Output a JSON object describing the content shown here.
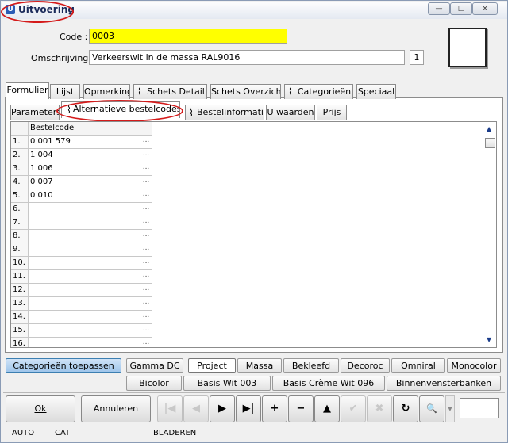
{
  "window": {
    "title": "Uitvoering",
    "title_icon": "U",
    "controls": [
      "—",
      "□",
      "×"
    ]
  },
  "form": {
    "code_label": "Code :",
    "code_value": "0003",
    "code_highlight_color": "#ffff00",
    "desc_label": "Omschrijving :",
    "desc_value": "Verkeerswit in de massa RAL9016",
    "desc_badge": "1"
  },
  "tabs_main": [
    "Formulier",
    "Lijst",
    "Opmerking",
    "Schets Detail",
    "Schets Overzicht",
    "Categorieën",
    "Speciaal"
  ],
  "tabs_sub": [
    "Parameters",
    "Alternatieve bestelcodes",
    "Bestelinformatie",
    "U waarden",
    "Prijs"
  ],
  "grid": {
    "column_header": "Bestelcode",
    "dots": "...",
    "rows": [
      {
        "n": "1.",
        "v": "0 001 579"
      },
      {
        "n": "2.",
        "v": "1 004"
      },
      {
        "n": "3.",
        "v": "1 006"
      },
      {
        "n": "4.",
        "v": "0 007"
      },
      {
        "n": "5.",
        "v": "0 010"
      },
      {
        "n": "6.",
        "v": ""
      },
      {
        "n": "7.",
        "v": ""
      },
      {
        "n": "8.",
        "v": ""
      },
      {
        "n": "9.",
        "v": ""
      },
      {
        "n": "10.",
        "v": ""
      },
      {
        "n": "11.",
        "v": ""
      },
      {
        "n": "12.",
        "v": ""
      },
      {
        "n": "13.",
        "v": ""
      },
      {
        "n": "14.",
        "v": ""
      },
      {
        "n": "15.",
        "v": ""
      },
      {
        "n": "16.",
        "v": ""
      }
    ]
  },
  "categories": {
    "apply": "Categorieën toepassen",
    "row1": [
      "Gamma DC",
      "Project",
      "Massa",
      "Bekleefd",
      "Decoroc",
      "Omniral",
      "Monocolor"
    ],
    "row2": [
      "Bicolor",
      "Basis Wit 003",
      "Basis Crème Wit 096",
      "Binnenvensterbanken"
    ]
  },
  "buttons": {
    "ok": "Ok",
    "cancel": "Annuleren"
  },
  "nav_icons": [
    "first-icon",
    "prev-icon",
    "next-icon",
    "last-icon",
    "add-icon",
    "delete-icon",
    "up-icon",
    "confirm-icon",
    "cancel-icon",
    "refresh-icon",
    "binoculars-icon"
  ],
  "nav_glyphs": [
    "|◀",
    "◀",
    "▶",
    "▶|",
    "+",
    "−",
    "▲",
    "✔",
    "✖",
    "↻",
    "🔍"
  ],
  "status": {
    "s1": "AUTO",
    "s2": "CAT",
    "s3": "BLADEREN"
  }
}
